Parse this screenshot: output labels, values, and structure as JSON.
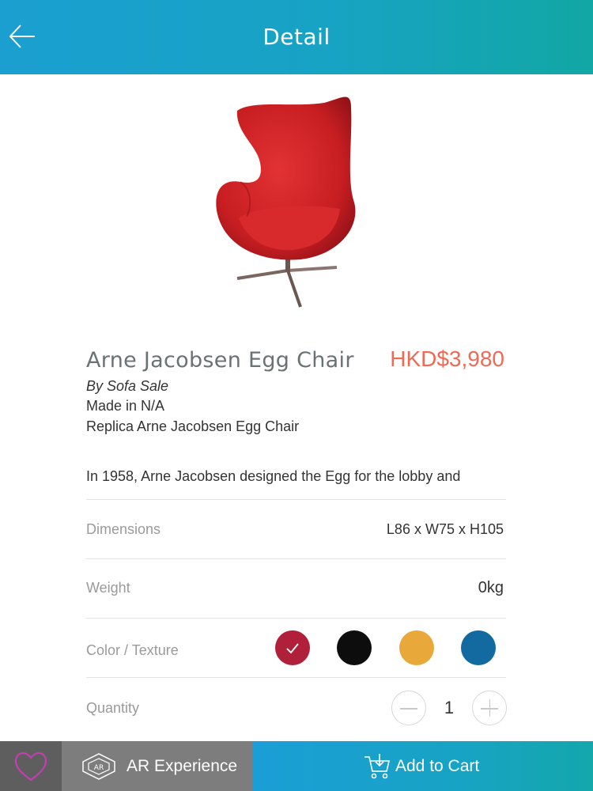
{
  "header": {
    "title": "Detail",
    "back_icon": "arrow-left-icon"
  },
  "product": {
    "name": "Arne Jacobsen Egg Chair",
    "price": "HKD$3,980",
    "brand": "By Sofa Sale",
    "origin": "Made in N/A",
    "subtitle": "Replica Arne Jacobsen Egg Chair",
    "description": "In 1958, Arne Jacobsen designed the Egg for the lobby and"
  },
  "specs": {
    "dimensions_label": "Dimensions",
    "dimensions_value": "L86 x W75 x H105",
    "weight_label": "Weight",
    "weight_value": "0kg",
    "color_label": "Color / Texture",
    "colors": [
      {
        "name": "red",
        "hex": "#b0203a",
        "selected": true
      },
      {
        "name": "black",
        "hex": "#0d0d0d",
        "selected": false
      },
      {
        "name": "yellow",
        "hex": "#e8a93a",
        "selected": false
      },
      {
        "name": "blue",
        "hex": "#136aa0",
        "selected": false
      }
    ],
    "quantity_label": "Quantity",
    "quantity_value": "1"
  },
  "bottom_bar": {
    "favorite_icon": "heart-icon",
    "ar_label": "AR Experience",
    "ar_icon": "ar-cube-icon",
    "cart_label": "Add to Cart",
    "cart_icon": "cart-icon"
  },
  "colors": {
    "accent": "#17a3c4",
    "price": "#ef6a55",
    "heart": "#c23fb0"
  }
}
